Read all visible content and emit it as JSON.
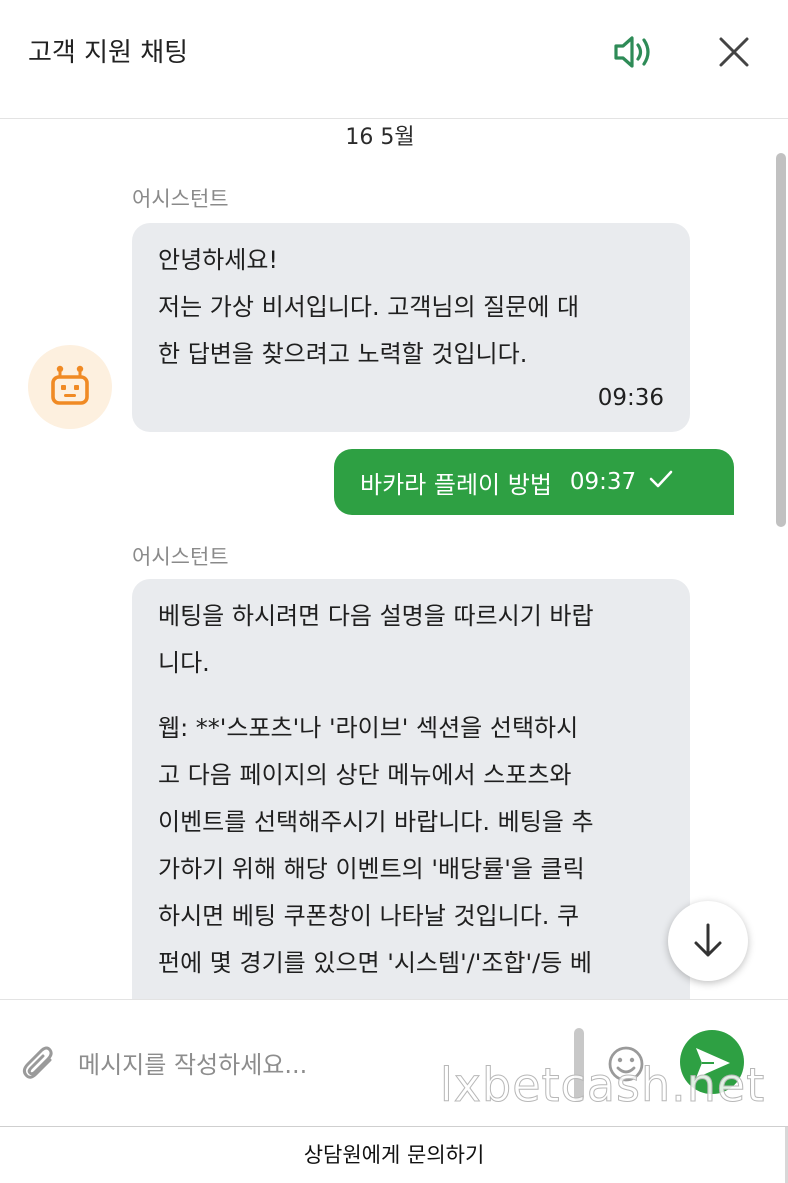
{
  "header": {
    "title": "고객 지원 채팅"
  },
  "icons": {
    "sound": "speaker-volume-icon",
    "close": "close-x-icon",
    "bot": "robot-icon",
    "check": "check-mark-icon",
    "scroll_down": "arrow-down-icon",
    "attach": "paperclip-icon",
    "emoji": "smiley-icon",
    "send": "paper-plane-icon"
  },
  "colors": {
    "accent_green": "#2ea043",
    "bot_bubble": "#e9ebee",
    "avatar_bg": "#fdf0df",
    "avatar_icon": "#f08a24"
  },
  "chat": {
    "date_separator": "16 5월",
    "messages": [
      {
        "sender": "어시스턴트",
        "lines": [
          "안녕하세요!",
          "저는 가상 비서입니다. 고객님의 질문에 대",
          "한 답변을 찾으려고 노력할 것입니다."
        ],
        "time": "09:36"
      },
      {
        "text": "바카라 플레이 방법",
        "time": "09:37"
      },
      {
        "sender": "어시스턴트",
        "para1": [
          "베팅을 하시려면 다음 설명을 따르시기 바랍",
          "니다."
        ],
        "para2": [
          "웹: **'스포츠'나 '라이브' 섹션을 선택하시",
          "고 다음 페이지의 상단 메뉴에서 스포츠와",
          "이벤트를 선택해주시기 바랍니다. 베팅을 추",
          "가하기 위해 해당 이벤트의 '배당률'을 클릭",
          "하시면 베팅 쿠폰창이 나타날 것입니다. 쿠",
          "펀에 몇 경기를 있으면 '시스템'/'조합'/등 베"
        ]
      }
    ]
  },
  "composer": {
    "placeholder": "메시지를 작성하세요...",
    "value": "",
    "watermark": "lxbetcash.net"
  },
  "footer": {
    "label": "상담원에게 문의하기"
  }
}
